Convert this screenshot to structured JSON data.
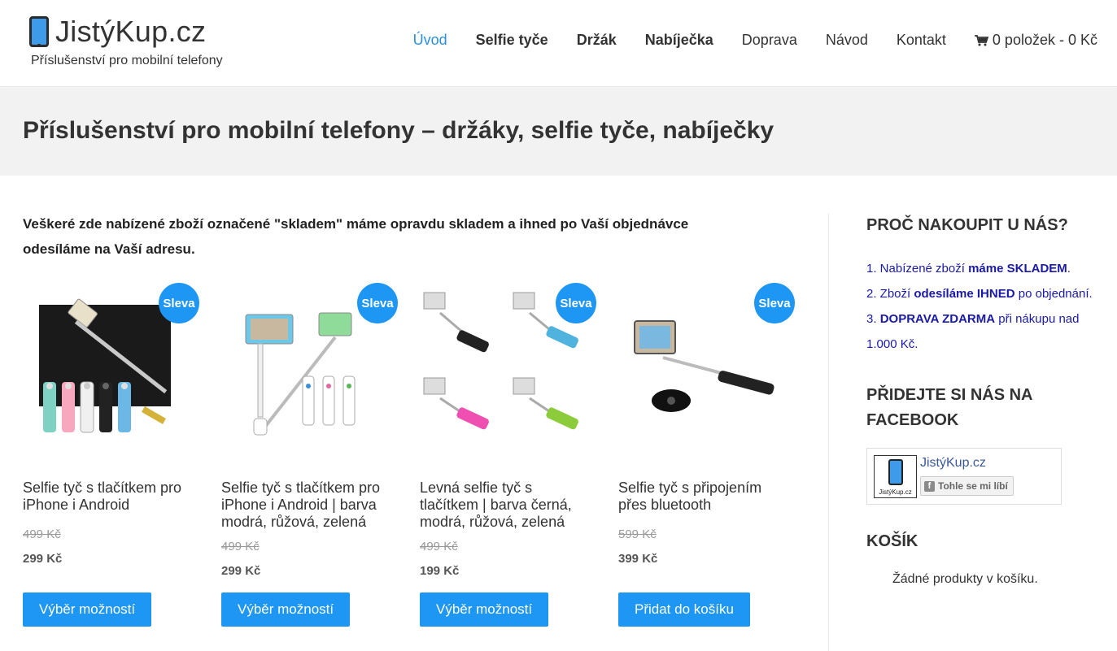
{
  "header": {
    "logo_text": "JistýKup.cz",
    "tagline": "Příslušenství pro mobilní telefony",
    "nav": [
      {
        "label": "Úvod",
        "active": true,
        "bold": false
      },
      {
        "label": "Selfie tyče",
        "active": false,
        "bold": true
      },
      {
        "label": "Držák",
        "active": false,
        "bold": true
      },
      {
        "label": "Nabíječka",
        "active": false,
        "bold": true
      },
      {
        "label": "Doprava",
        "active": false,
        "bold": false
      },
      {
        "label": "Návod",
        "active": false,
        "bold": false
      },
      {
        "label": "Kontakt",
        "active": false,
        "bold": false
      }
    ],
    "cart_label": "0 položek - 0 Kč",
    "cart_icon": "shopping-cart-icon"
  },
  "banner": {
    "title": "Příslušenství pro mobilní telefony – držáky, selfie tyče, nabíječky"
  },
  "main": {
    "intro": "Veškeré zde nabízené zboží označené \"skladem\" máme opravdu skladem a ihned po Vaší objednávce odesíláme na Vaší adresu.",
    "products": [
      {
        "badge": "Sleva",
        "title": "Selfie tyč s tlačítkem pro iPhone i Android",
        "old_price": "499 Kč",
        "price": "299 Kč",
        "button": "Výběr možností"
      },
      {
        "badge": "Sleva",
        "title": "Selfie tyč s tlačítkem pro iPhone i Android | barva modrá, růžová, zelená",
        "old_price": "499 Kč",
        "price": "299 Kč",
        "button": "Výběr možností"
      },
      {
        "badge": "Sleva",
        "title": "Levná selfie tyč s tlačítkem | barva černá, modrá, růžová, zelená",
        "old_price": "499 Kč",
        "price": "199 Kč",
        "button": "Výběr možností"
      },
      {
        "badge": "Sleva",
        "title": "Selfie tyč s připojením přes bluetooth",
        "old_price": "599 Kč",
        "price": "399 Kč",
        "button": "Přidat do košíku"
      }
    ]
  },
  "sidebar": {
    "why_heading": "PROČ NAKOUPIT U NÁS?",
    "why_1_a": "1. Nabízené zboží ",
    "why_1_b": "máme SKLADEM",
    "why_1_c": ".",
    "why_2_a": "2. Zboží ",
    "why_2_b": "odesíláme IHNED",
    "why_2_c": " po objednání.",
    "why_3_a": "3. ",
    "why_3_b": "DOPRAVA ZDARMA",
    "why_3_c": " při nákupu nad 1.000 Kč.",
    "fb_heading": "PŘIDEJTE SI NÁS NA FACEBOOK",
    "fb_page_name": "JistýKup.cz",
    "fb_logo_text": "JistýKup.cz",
    "fb_like_label": "Tohle se mi líbí",
    "cart_heading": "KOŠÍK",
    "cart_empty": "Žádné produkty v košíku."
  },
  "colors": {
    "accent": "#1e96f3",
    "nav_active": "#2b8fe0",
    "sidebar_link": "#1a1aa8"
  }
}
